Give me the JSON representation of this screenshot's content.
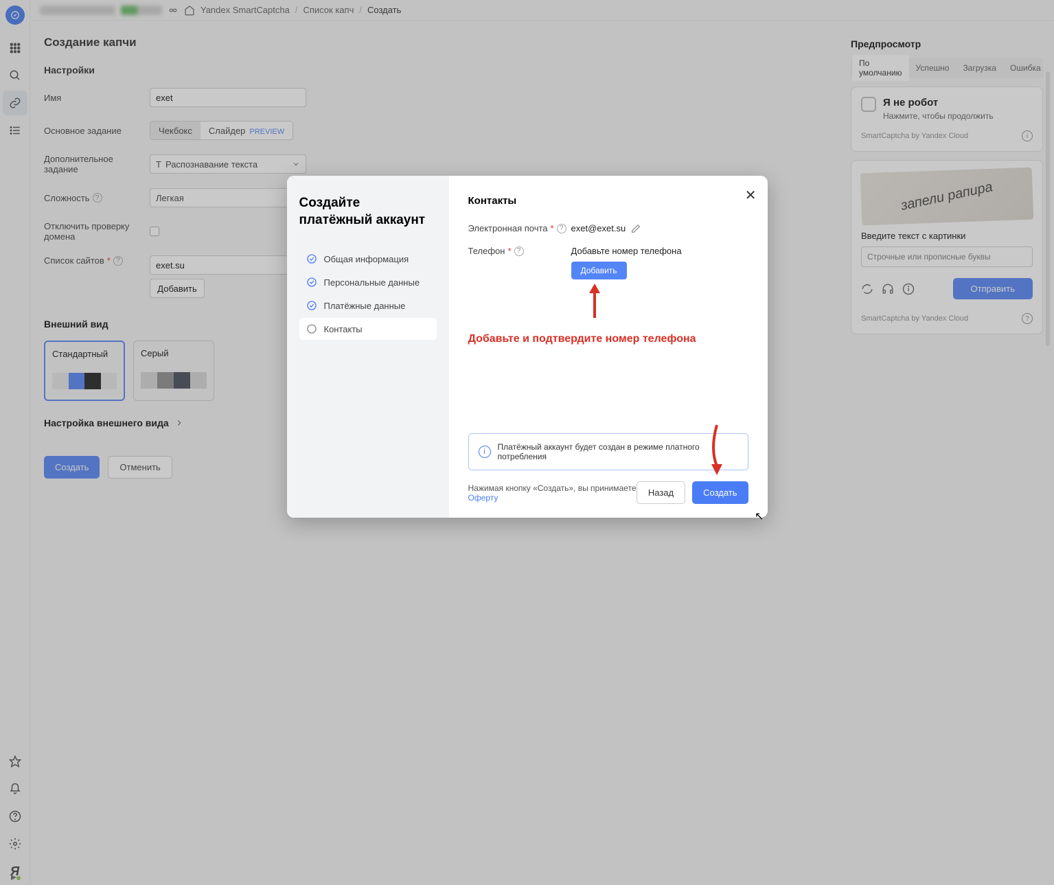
{
  "breadcrumbs": {
    "service": "Yandex SmartCaptcha",
    "list": "Список капч",
    "create": "Создать"
  },
  "page": {
    "title": "Создание капчи",
    "settings": "Настройки",
    "name_label": "Имя",
    "name_value": "exet",
    "main_task_label": "Основное задание",
    "checkbox_opt": "Чекбокс",
    "slider_opt": "Слайдер",
    "preview_badge": "PREVIEW",
    "extra_task_label": "Дополнительное задание",
    "extra_task_value": "Распознавание текста",
    "difficulty_label": "Сложность",
    "difficulty_value": "Легкая",
    "disable_domain_label": "Отключить проверку домена",
    "sites_label": "Список сайтов",
    "site_value": "exet.su",
    "add_site": "Добавить",
    "appearance_title": "Внешний вид",
    "theme_standard": "Стандартный",
    "theme_gray": "Серый",
    "customize": "Настройка внешнего вида",
    "create_btn": "Создать",
    "cancel_btn": "Отменить"
  },
  "preview": {
    "title": "Предпросмотр",
    "tab_default": "По умолчанию",
    "tab_success": "Успешно",
    "tab_loading": "Загрузка",
    "tab_error": "Ошибка",
    "robot_title": "Я не робот",
    "robot_sub": "Нажмите, чтобы продолжить",
    "by_line": "SmartCaptcha by Yandex Cloud",
    "captcha_text": "запели рапира",
    "prompt": "Введите текст с картинки",
    "placeholder": "Строчные или прописные буквы",
    "send": "Отправить",
    "footer_by": "SmartCaptcha by Yandex Cloud"
  },
  "modal": {
    "title": "Создайте платёжный аккаунт",
    "step1": "Общая информация",
    "step2": "Персональные данные",
    "step3": "Платёжные данные",
    "step4": "Контакты",
    "contacts_heading": "Контакты",
    "email_label": "Электронная почта",
    "email_value": "exet@exet.su",
    "phone_label": "Телефон",
    "phone_prompt": "Добавьте номер телефона",
    "add_btn": "Добавить",
    "annotation": "Добавьте и подтвердите номер телефона",
    "banner": "Платёжный аккаунт будет создан в режиме платного потребления",
    "terms_prefix": "Нажимая кнопку «Создать», вы принимаете ",
    "terms_link": "Оферту",
    "back": "Назад",
    "create": "Создать"
  }
}
